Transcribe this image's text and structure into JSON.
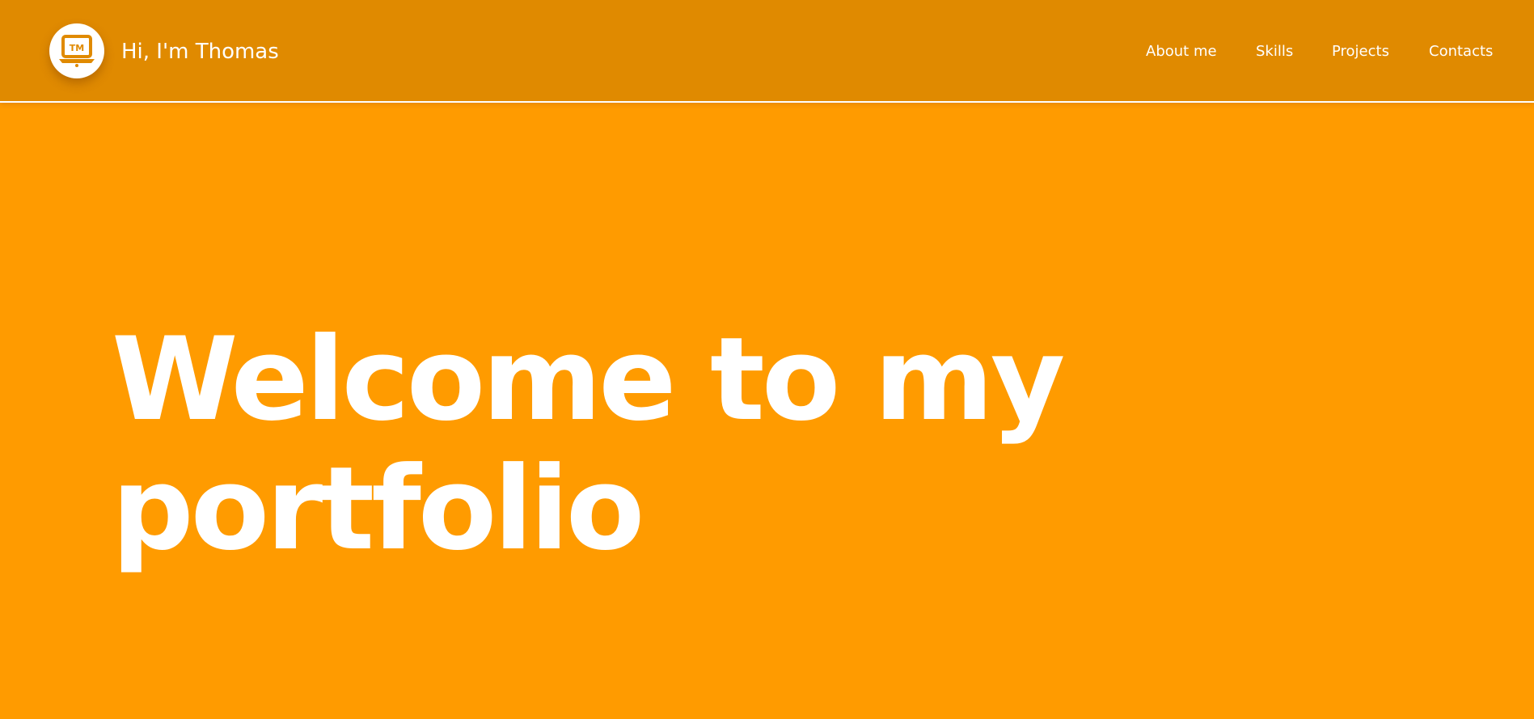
{
  "header": {
    "logo": {
      "icon": "laptop-icon",
      "text": "TM"
    },
    "brand_name": "Hi, I'm Thomas"
  },
  "nav": {
    "items": [
      {
        "label": "About me"
      },
      {
        "label": "Skills"
      },
      {
        "label": "Projects"
      },
      {
        "label": "Contacts"
      }
    ]
  },
  "hero": {
    "title_line1": "Welcome to my",
    "title_line2": "portfolio"
  },
  "colors": {
    "background": "#ff9b00",
    "header": "#e08a00",
    "text": "#ffffff"
  }
}
